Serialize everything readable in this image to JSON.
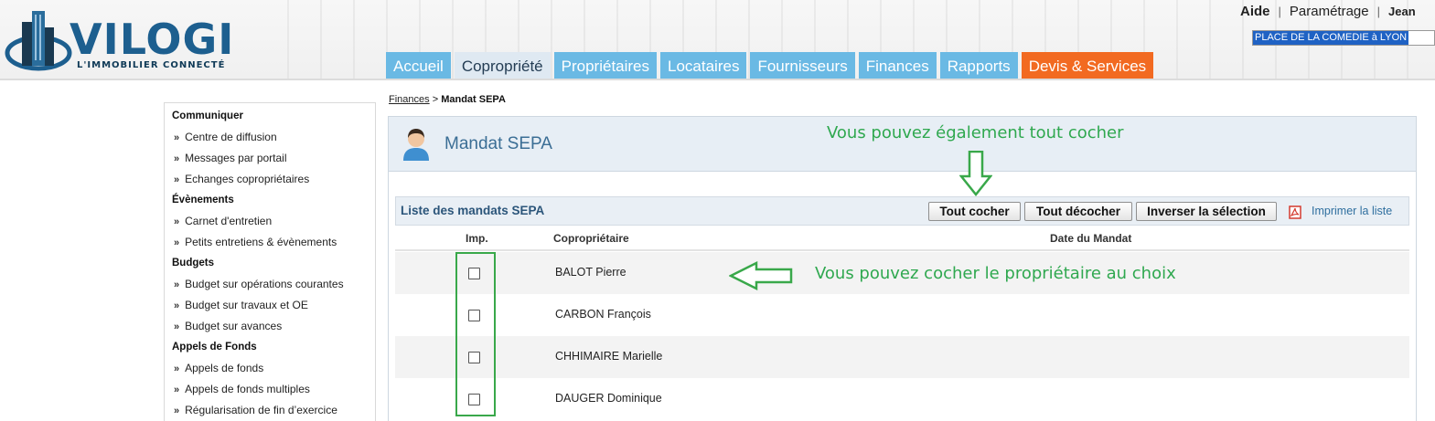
{
  "header": {
    "logo_text": "VILOGI",
    "logo_tagline": "L'IMMOBILIER CONNECTÉ",
    "links": [
      "Aide",
      "Paramétrage",
      "Jean"
    ],
    "coprop_select": "PLACE DE LA COMEDIE à LYON",
    "tabs": [
      {
        "label": "Accueil",
        "active": false
      },
      {
        "label": "Copropriété",
        "active": true
      },
      {
        "label": "Propriétaires",
        "active": false
      },
      {
        "label": "Locataires",
        "active": false
      },
      {
        "label": "Fournisseurs",
        "active": false
      },
      {
        "label": "Finances",
        "active": false
      },
      {
        "label": "Rapports",
        "active": false
      },
      {
        "label": "Devis & Services",
        "active": false
      }
    ]
  },
  "sidebar": {
    "groups": [
      {
        "title": "Communiquer",
        "items": [
          "Centre de diffusion",
          "Messages par portail",
          "Echanges copropriétaires"
        ]
      },
      {
        "title": "Évènements",
        "items": [
          "Carnet d'entretien",
          "Petits entretiens & évènements"
        ]
      },
      {
        "title": "Budgets",
        "items": [
          "Budget sur opérations courantes",
          "Budget sur travaux et OE",
          "Budget sur avances"
        ]
      },
      {
        "title": "Appels de Fonds",
        "items": [
          "Appels de fonds",
          "Appels de fonds multiples",
          "Régularisation de fin d’exercice"
        ]
      }
    ]
  },
  "breadcrumb": {
    "link": "Finances",
    "separator": ">",
    "current": "Mandat SEPA"
  },
  "panel": {
    "title": "Mandat SEPA",
    "list_title": "Liste des mandats SEPA",
    "buttons": {
      "check_all": "Tout cocher",
      "uncheck_all": "Tout décocher",
      "invert": "Inverser la sélection"
    },
    "print_link": "Imprimer la liste",
    "columns": [
      "Imp.",
      "Copropriétaire",
      "Date du Mandat"
    ],
    "rows": [
      {
        "name": "BALOT Pierre",
        "checked": false,
        "date": ""
      },
      {
        "name": "CARBON François",
        "checked": false,
        "date": ""
      },
      {
        "name": "CHHIMAIRE Marielle",
        "checked": false,
        "date": ""
      },
      {
        "name": "DAUGER Dominique",
        "checked": false,
        "date": ""
      }
    ]
  },
  "annotations": {
    "check_all_hint": "Vous pouvez également tout cocher",
    "row_hint": "Vous pouvez cocher le propriétaire au choix",
    "color": "#2fa84f"
  },
  "colors": {
    "tab_blue": "#6ab9e4",
    "tab_orange": "#f26a21",
    "title_blue": "#3b6e95"
  }
}
